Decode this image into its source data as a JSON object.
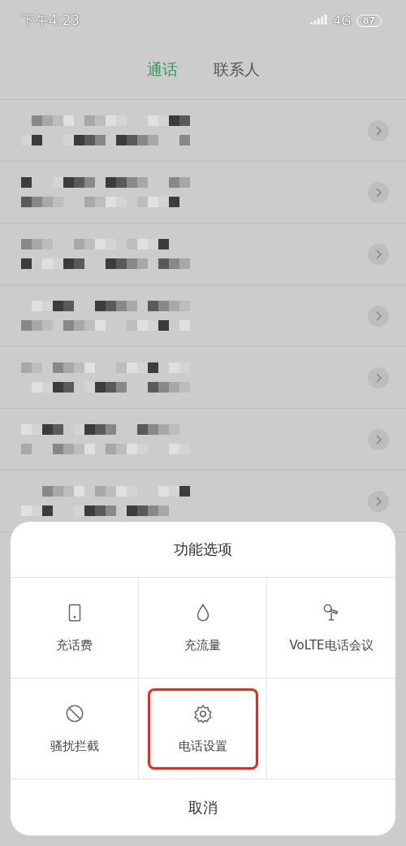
{
  "status_bar": {
    "time": "下午4:23",
    "network": "4G",
    "battery": "87"
  },
  "tabs": [
    {
      "label": "通话",
      "selected": true
    },
    {
      "label": "联系人",
      "selected": false
    }
  ],
  "call_log": {
    "rows": [
      {
        "kind": "pixelated"
      },
      {
        "kind": "pixelated"
      },
      {
        "kind": "pixelated"
      },
      {
        "kind": "pixelated"
      },
      {
        "kind": "pixelated"
      },
      {
        "kind": "pixelated"
      },
      {
        "kind": "pixelated"
      }
    ]
  },
  "sheet": {
    "title": "功能选项",
    "options": [
      {
        "label": "充话费",
        "kind": "tablet",
        "highlighted": false
      },
      {
        "label": "充流量",
        "kind": "drop",
        "highlighted": false
      },
      {
        "label": "VoLTE电话会议",
        "kind": "microphone",
        "highlighted": false
      },
      {
        "label": "骚扰拦截",
        "kind": "block",
        "highlighted": false
      },
      {
        "label": "电话设置",
        "kind": "gear",
        "highlighted": true
      }
    ],
    "cancel": "取消"
  }
}
